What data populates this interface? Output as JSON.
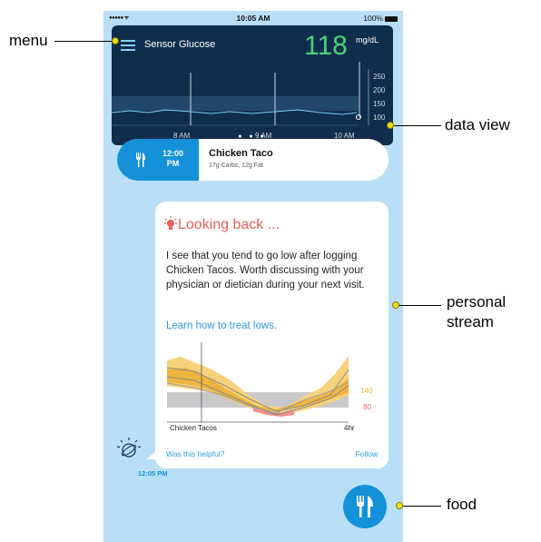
{
  "status_bar": {
    "signal": "●●●●● ᯤ",
    "time": "10:05 AM",
    "battery": "100%"
  },
  "data_view": {
    "label": "Sensor Glucose",
    "value": "118",
    "unit": "mg/dL",
    "y_ticks": [
      "250",
      "200",
      "150",
      "100"
    ],
    "x_ticks": [
      "8 AM",
      "9 AM",
      "10 AM"
    ],
    "page_dots": "● ● ●"
  },
  "meal": {
    "time": "12:00",
    "period": "PM",
    "name": "Chicken Taco",
    "details": "17g Carbs, 12g Fat"
  },
  "insight": {
    "title": "Looking back ...",
    "body": "I see that you tend to go low after logging Chicken Tacos. Worth discussing with your physician or dietician during your next visit.",
    "link": "Learn how to treat lows.",
    "threshold_high": "140",
    "threshold_low": "80",
    "axis_left": "Chicken Tacos",
    "axis_right": "4hr",
    "helpful": "Was this helpful?",
    "follow": "Follow"
  },
  "stream_time": "12:05 PM",
  "callouts": {
    "menu": "menu",
    "data_view": "data view",
    "personal_stream": "personal stream",
    "food": "food"
  },
  "colors": {
    "background": "#b9dff8",
    "data_view_bg": "#0f2d4d",
    "glucose_value": "#4cd07a",
    "accent_blue": "#1491d8",
    "alert_red": "#e8605b",
    "threshold_yellow": "#f0b43c",
    "callout_dot": "#f2dc1a"
  },
  "icons": [
    "hamburger-icon",
    "fork-knife-icon",
    "lightbulb-icon",
    "watson-icon"
  ]
}
